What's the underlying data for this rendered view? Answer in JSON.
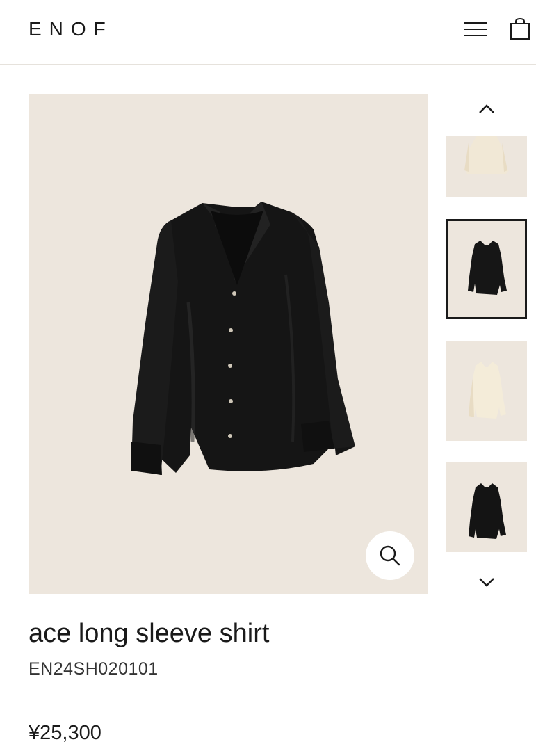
{
  "header": {
    "logo": "ENOF",
    "menu_icon": "hamburger-menu-icon",
    "cart_icon": "shopping-bag-icon"
  },
  "gallery": {
    "main_image_alt": "ace long sleeve shirt black",
    "zoom_icon": "magnifier-icon",
    "thumbnails": [
      {
        "color": "ivory",
        "selected": false
      },
      {
        "color": "black",
        "selected": true
      },
      {
        "color": "ivory",
        "selected": false
      },
      {
        "color": "black",
        "selected": false
      }
    ],
    "up_icon": "chevron-up-icon",
    "down_icon": "chevron-down-icon",
    "background_color": "#ede6dd"
  },
  "product": {
    "title": "ace long sleeve shirt",
    "code": "EN24SH020101",
    "price": "¥25,300"
  }
}
